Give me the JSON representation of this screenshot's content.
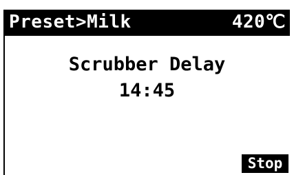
{
  "header": {
    "title": "Preset>Milk",
    "temperature": "420℃"
  },
  "main": {
    "label": "Scrubber Delay",
    "value": "14:45"
  },
  "softkeys": {
    "stop_label": "Stop"
  }
}
